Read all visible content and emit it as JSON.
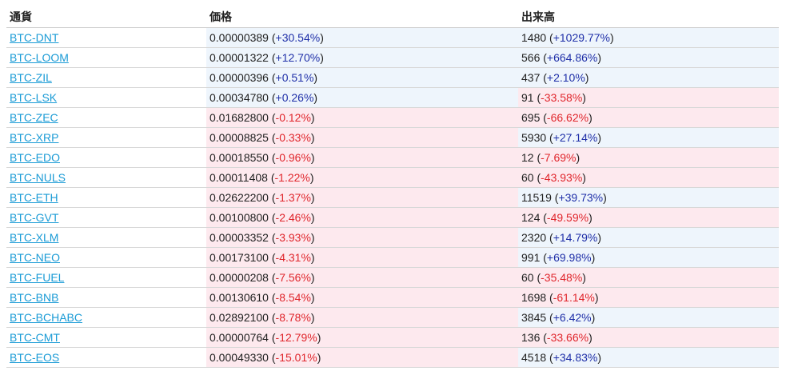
{
  "table": {
    "headers": [
      "通貨",
      "価格",
      "出来高"
    ],
    "colors": {
      "link": "#1a9bd6",
      "positive_text": "#1f2fa8",
      "negative_text": "#e0262c",
      "positive_bg": "#eef5fc",
      "negative_bg": "#fde9ee"
    },
    "rows": [
      {
        "pair": "BTC-DNT",
        "price": "0.00000389",
        "price_change": "+30.54%",
        "volume": "1480",
        "volume_change": "+1029.77%"
      },
      {
        "pair": "BTC-LOOM",
        "price": "0.00001322",
        "price_change": "+12.70%",
        "volume": "566",
        "volume_change": "+664.86%"
      },
      {
        "pair": "BTC-ZIL",
        "price": "0.00000396",
        "price_change": "+0.51%",
        "volume": "437",
        "volume_change": "+2.10%"
      },
      {
        "pair": "BTC-LSK",
        "price": "0.00034780",
        "price_change": "+0.26%",
        "volume": "91",
        "volume_change": "-33.58%"
      },
      {
        "pair": "BTC-ZEC",
        "price": "0.01682800",
        "price_change": "-0.12%",
        "volume": "695",
        "volume_change": "-66.62%"
      },
      {
        "pair": "BTC-XRP",
        "price": "0.00008825",
        "price_change": "-0.33%",
        "volume": "5930",
        "volume_change": "+27.14%"
      },
      {
        "pair": "BTC-EDO",
        "price": "0.00018550",
        "price_change": "-0.96%",
        "volume": "12",
        "volume_change": "-7.69%"
      },
      {
        "pair": "BTC-NULS",
        "price": "0.00011408",
        "price_change": "-1.22%",
        "volume": "60",
        "volume_change": "-43.93%"
      },
      {
        "pair": "BTC-ETH",
        "price": "0.02622200",
        "price_change": "-1.37%",
        "volume": "11519",
        "volume_change": "+39.73%"
      },
      {
        "pair": "BTC-GVT",
        "price": "0.00100800",
        "price_change": "-2.46%",
        "volume": "124",
        "volume_change": "-49.59%"
      },
      {
        "pair": "BTC-XLM",
        "price": "0.00003352",
        "price_change": "-3.93%",
        "volume": "2320",
        "volume_change": "+14.79%"
      },
      {
        "pair": "BTC-NEO",
        "price": "0.00173100",
        "price_change": "-4.31%",
        "volume": "991",
        "volume_change": "+69.98%"
      },
      {
        "pair": "BTC-FUEL",
        "price": "0.00000208",
        "price_change": "-7.56%",
        "volume": "60",
        "volume_change": "-35.48%"
      },
      {
        "pair": "BTC-BNB",
        "price": "0.00130610",
        "price_change": "-8.54%",
        "volume": "1698",
        "volume_change": "-61.14%"
      },
      {
        "pair": "BTC-BCHABC",
        "price": "0.02892100",
        "price_change": "-8.78%",
        "volume": "3845",
        "volume_change": "+6.42%"
      },
      {
        "pair": "BTC-CMT",
        "price": "0.00000764",
        "price_change": "-12.79%",
        "volume": "136",
        "volume_change": "-33.66%"
      },
      {
        "pair": "BTC-EOS",
        "price": "0.00049330",
        "price_change": "-15.01%",
        "volume": "4518",
        "volume_change": "+34.83%"
      }
    ]
  }
}
